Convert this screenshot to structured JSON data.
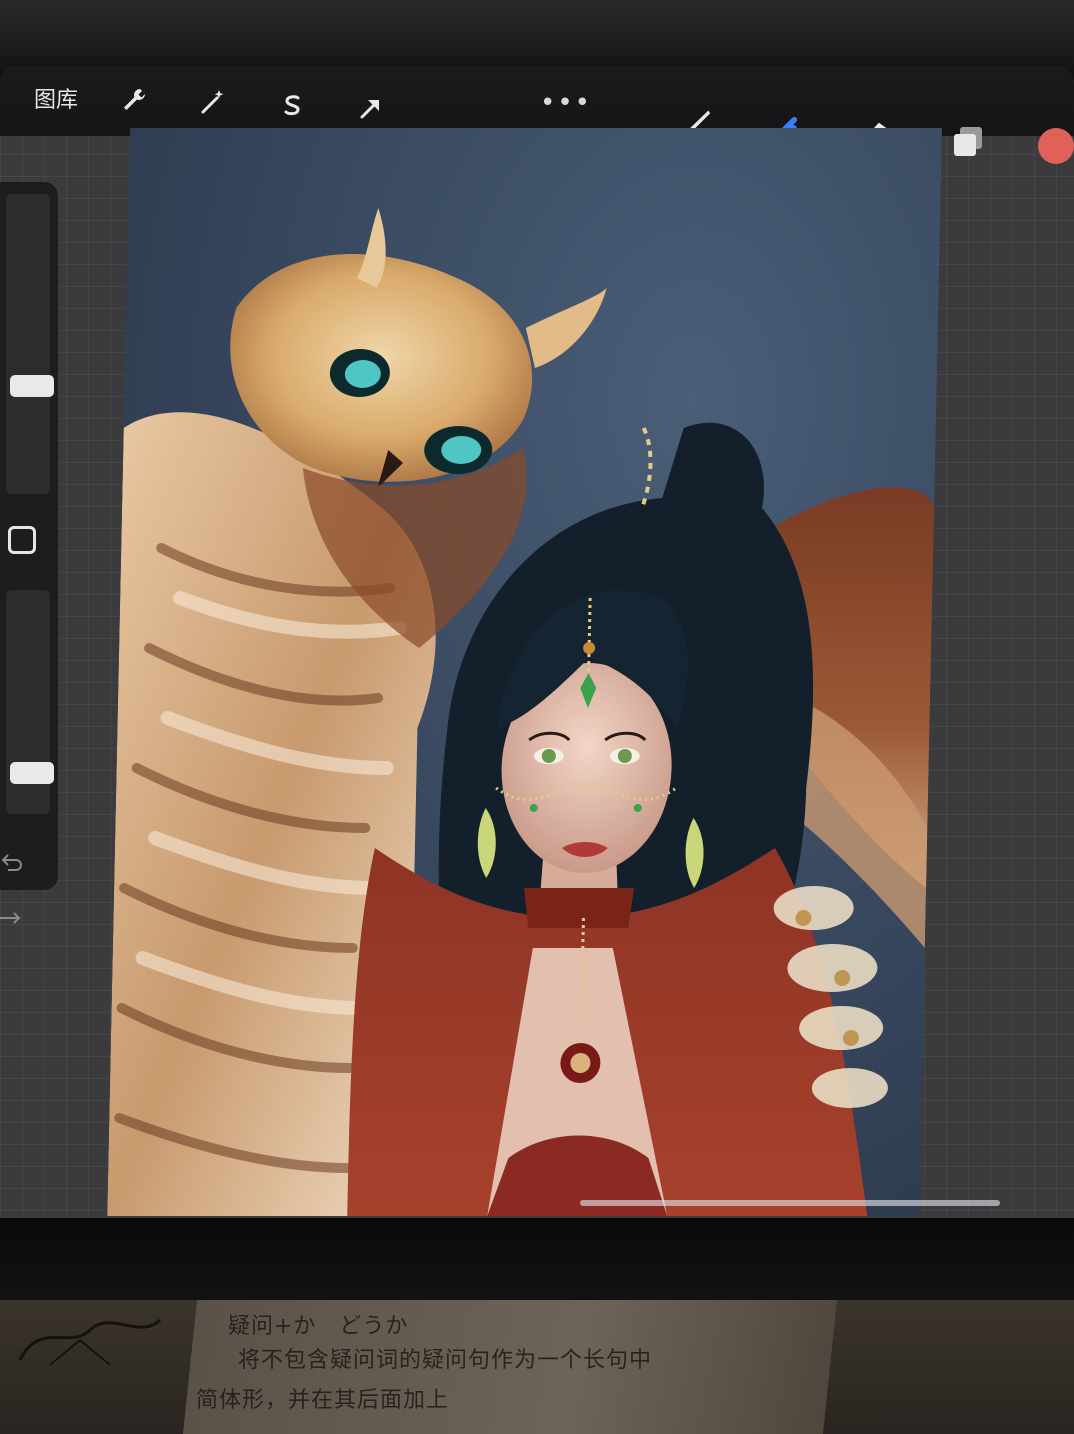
{
  "toolbar": {
    "gallery_label": "图库",
    "more_label": "•••",
    "icons": {
      "actions": "wrench-icon",
      "adjustments": "magic-wand-icon",
      "selection": "selection-s-icon",
      "transform": "arrow-cursor-icon",
      "paint": "brush-icon",
      "smudge": "smudge-finger-icon",
      "erase": "eraser-icon",
      "layers": "layers-icon"
    },
    "active_tool_color": "#3a7dff",
    "current_color": "#e0605a"
  },
  "sidebar": {
    "brush_size_level": 0.35,
    "opacity_level": 0.15
  },
  "book": {
    "line1": "疑问+か　どうか",
    "line2": "将不包含疑问词的疑问句作为一个长句中",
    "line3": "简体形，并在其后面加上"
  }
}
